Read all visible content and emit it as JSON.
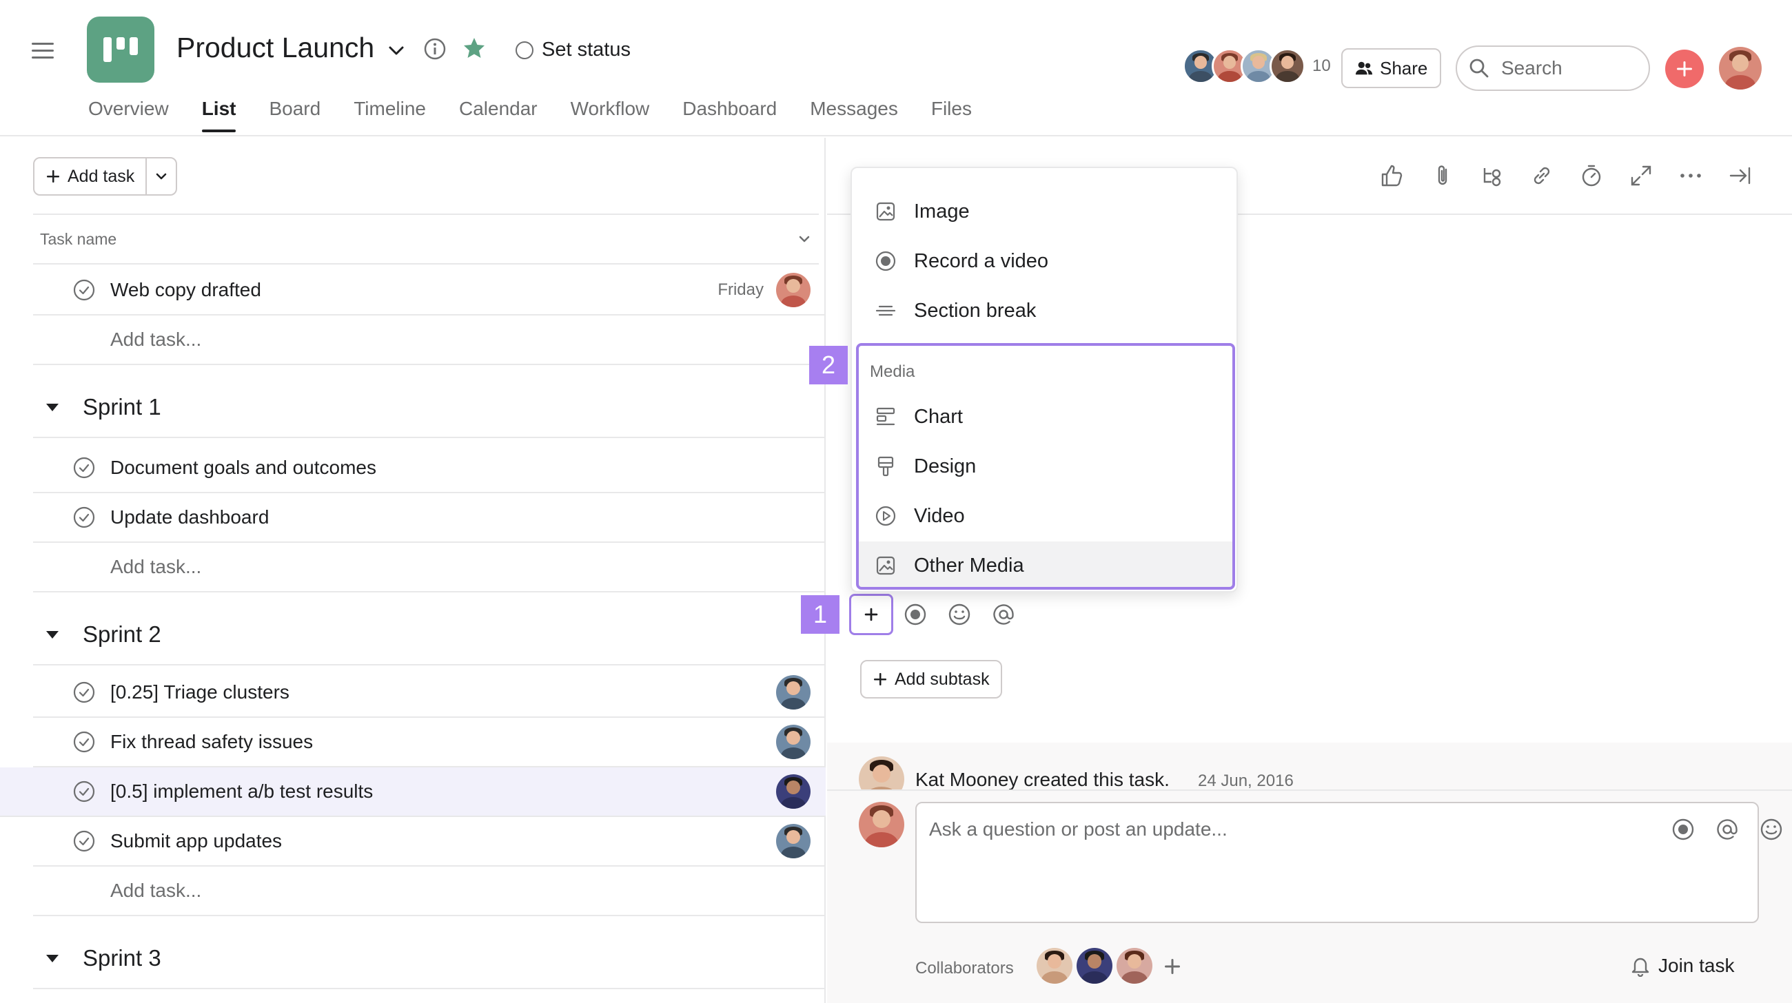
{
  "header": {
    "project_title": "Product Launch",
    "set_status": "Set status",
    "member_count": "10",
    "share_label": "Share",
    "search_placeholder": "Search",
    "brand_color": "#5da283",
    "accent_red": "#f06a6a",
    "star_color": "#5da283"
  },
  "tabs": [
    {
      "label": "Overview"
    },
    {
      "label": "List",
      "active": true
    },
    {
      "label": "Board"
    },
    {
      "label": "Timeline"
    },
    {
      "label": "Calendar"
    },
    {
      "label": "Workflow"
    },
    {
      "label": "Dashboard"
    },
    {
      "label": "Messages"
    },
    {
      "label": "Files"
    }
  ],
  "list": {
    "add_task_label": "Add task",
    "column_task_name": "Task name",
    "add_task_placeholder": "Add task...",
    "top_tasks": [
      {
        "label": "Web copy drafted",
        "due": "Friday"
      }
    ],
    "sections": [
      {
        "title": "Sprint 1",
        "tasks": [
          {
            "label": "Document goals and outcomes"
          },
          {
            "label": "Update dashboard"
          }
        ]
      },
      {
        "title": "Sprint 2",
        "tasks": [
          {
            "label": "[0.25] Triage clusters"
          },
          {
            "label": "Fix thread safety issues"
          },
          {
            "label": "[0.5] implement a/b test results"
          },
          {
            "label": "Submit app updates"
          }
        ]
      },
      {
        "title": "Sprint 3",
        "tasks": []
      }
    ]
  },
  "insert_menu": {
    "items_top": [
      {
        "label": "Image",
        "icon": "image-icon"
      },
      {
        "label": "Record a video",
        "icon": "record-icon"
      },
      {
        "label": "Section break",
        "icon": "section-break-icon"
      }
    ],
    "media_heading": "Media",
    "media_items": [
      {
        "label": "Chart",
        "icon": "chart-icon"
      },
      {
        "label": "Design",
        "icon": "design-icon"
      },
      {
        "label": "Video",
        "icon": "play-icon"
      },
      {
        "label": "Other Media",
        "icon": "media-icon"
      }
    ],
    "highlight_color": "#9f7ee8"
  },
  "badges": {
    "one": "1",
    "two": "2"
  },
  "detail": {
    "add_subtask_label": "Add subtask",
    "activity_author": "Kat Mooney created this task.",
    "activity_date": "24 Jun, 2016",
    "comment_placeholder": "Ask a question or post an update...",
    "collaborators_label": "Collaborators",
    "join_task_label": "Join task"
  }
}
